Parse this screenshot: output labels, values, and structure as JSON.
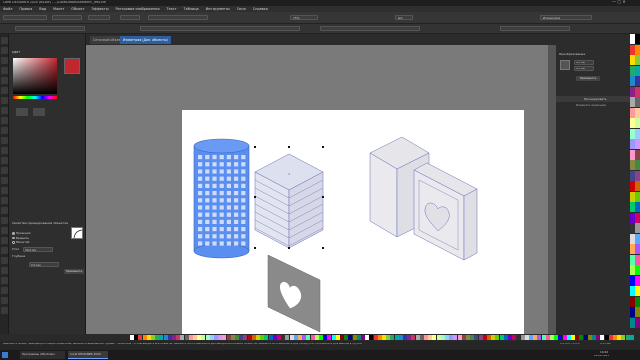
{
  "app": {
    "title": "Corel DESIGNER 2020 (64-Bit) - ...\\CorelDRAW\\Isometric_Test.cdr",
    "menu": [
      "Файл",
      "Правка",
      "Вид",
      "Макет",
      "Объект",
      "Эффекты",
      "Растровые изображения",
      "Текст",
      "Таблица",
      "Инструменты",
      "Окно",
      "Справка"
    ]
  },
  "document_tabs": [
    {
      "label": "Сеточный объект",
      "active": false
    },
    {
      "label": "Изометрия (Доп. объекты)",
      "active": true
    }
  ],
  "toolbar": {
    "zoom": "75%",
    "units": "мм",
    "x_label": "X:",
    "y_label": "Y:",
    "projection_label": "Изометрия"
  },
  "left_panel": {
    "title": "Цвет",
    "color_hex": "#c2262e",
    "projection_title": "Свойства проецирования объектов",
    "options": [
      "Проекция",
      "Вращать",
      "Масштаб"
    ],
    "angle_label": "Угол",
    "angle_value": "30.0 мм",
    "depth_label": "Глубина",
    "depth_value": "0.0 мм",
    "apply_button": "Применить"
  },
  "right_panel": {
    "title": "Преобразование",
    "field1": "0.0 мм",
    "field2": "0.0 мм",
    "apply_button": "Применить",
    "section": "Проецировать",
    "section2": "Изменить проекцию"
  },
  "statusbar": {
    "text": "Щелкните объект дважды для поворота/наклона; щелкните дважды инструмент 'Указатель', чтобы выбрать все объекты; нажмите Shift и щелкните для выбора нескольких объектов; нажмите Alt и щелкните для прокрутки, Ctrl+щелчок для выбора в группе",
    "fill": "C:0 M:0 Y:0 K:0",
    "outline": "0.25 мм"
  },
  "taskbar": {
    "items": [
      "Программы (Windows)",
      "Corel DESIGNER 2020"
    ],
    "time": "10:40",
    "date": "10.01.2021"
  },
  "colors": {
    "accent_blue": "#5a8ef0",
    "selection_blue": "#2d5f9e",
    "outline": "#6a6fb8",
    "shape_fill": "#e6e6ea",
    "heart_panel": "#8a8a8a"
  }
}
